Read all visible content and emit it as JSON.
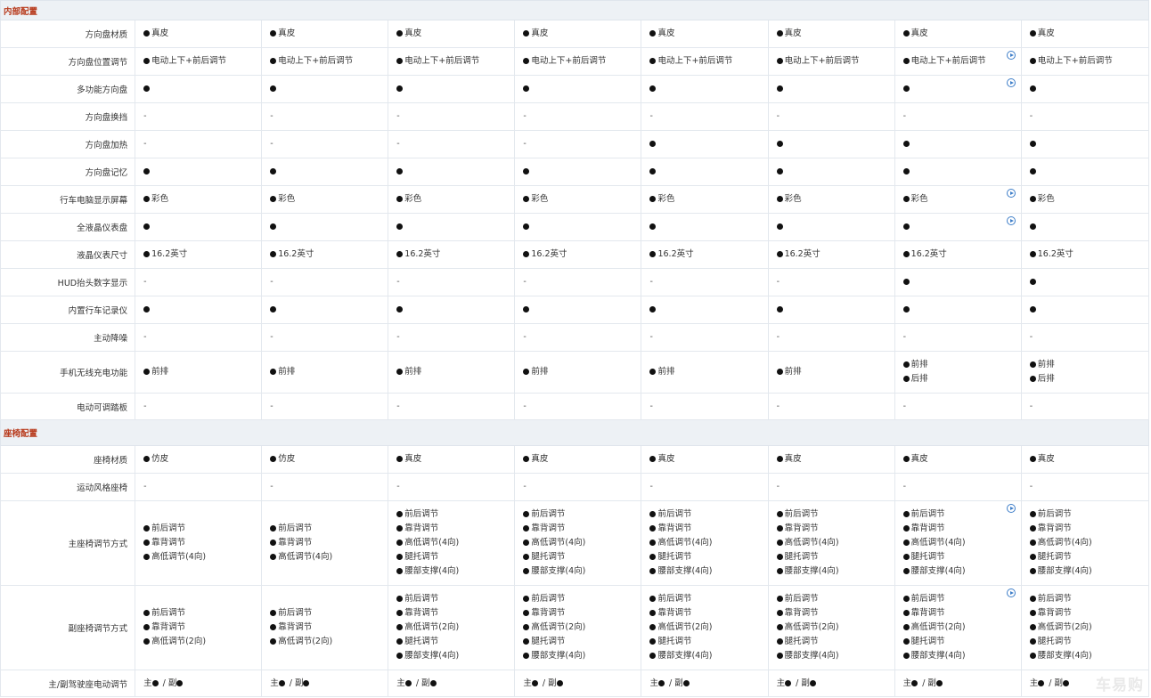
{
  "watermark": "车易购",
  "sections": [
    {
      "title": "内部配置",
      "rows": [
        {
          "label": "方向盘材质",
          "cells": [
            [
              "●真皮"
            ],
            [
              "●真皮"
            ],
            [
              "●真皮"
            ],
            [
              "●真皮"
            ],
            [
              "●真皮"
            ],
            [
              "●真皮"
            ],
            [
              "●真皮"
            ],
            [
              "●真皮"
            ]
          ],
          "icons": []
        },
        {
          "label": "方向盘位置调节",
          "cells": [
            [
              "●电动上下+前后调节"
            ],
            [
              "●电动上下+前后调节"
            ],
            [
              "●电动上下+前后调节"
            ],
            [
              "●电动上下+前后调节"
            ],
            [
              "●电动上下+前后调节"
            ],
            [
              "●电动上下+前后调节"
            ],
            [
              "●电动上下+前后调节"
            ],
            [
              "●电动上下+前后调节"
            ]
          ],
          "icons": [
            6
          ]
        },
        {
          "label": "多功能方向盘",
          "cells": [
            [
              "●"
            ],
            [
              "●"
            ],
            [
              "●"
            ],
            [
              "●"
            ],
            [
              "●"
            ],
            [
              "●"
            ],
            [
              "●"
            ],
            [
              "●"
            ]
          ],
          "icons": [
            6
          ]
        },
        {
          "label": "方向盘换挡",
          "cells": [
            [
              "-"
            ],
            [
              "-"
            ],
            [
              "-"
            ],
            [
              "-"
            ],
            [
              "-"
            ],
            [
              "-"
            ],
            [
              "-"
            ],
            [
              "-"
            ]
          ],
          "icons": []
        },
        {
          "label": "方向盘加热",
          "cells": [
            [
              "-"
            ],
            [
              "-"
            ],
            [
              "-"
            ],
            [
              "-"
            ],
            [
              "●"
            ],
            [
              "●"
            ],
            [
              "●"
            ],
            [
              "●"
            ]
          ],
          "icons": []
        },
        {
          "label": "方向盘记忆",
          "cells": [
            [
              "●"
            ],
            [
              "●"
            ],
            [
              "●"
            ],
            [
              "●"
            ],
            [
              "●"
            ],
            [
              "●"
            ],
            [
              "●"
            ],
            [
              "●"
            ]
          ],
          "icons": []
        },
        {
          "label": "行车电脑显示屏幕",
          "cells": [
            [
              "●彩色"
            ],
            [
              "●彩色"
            ],
            [
              "●彩色"
            ],
            [
              "●彩色"
            ],
            [
              "●彩色"
            ],
            [
              "●彩色"
            ],
            [
              "●彩色"
            ],
            [
              "●彩色"
            ]
          ],
          "icons": [
            6
          ]
        },
        {
          "label": "全液晶仪表盘",
          "cells": [
            [
              "●"
            ],
            [
              "●"
            ],
            [
              "●"
            ],
            [
              "●"
            ],
            [
              "●"
            ],
            [
              "●"
            ],
            [
              "●"
            ],
            [
              "●"
            ]
          ],
          "icons": [
            6
          ]
        },
        {
          "label": "液晶仪表尺寸",
          "cells": [
            [
              "●16.2英寸"
            ],
            [
              "●16.2英寸"
            ],
            [
              "●16.2英寸"
            ],
            [
              "●16.2英寸"
            ],
            [
              "●16.2英寸"
            ],
            [
              "●16.2英寸"
            ],
            [
              "●16.2英寸"
            ],
            [
              "●16.2英寸"
            ]
          ],
          "icons": []
        },
        {
          "label": "HUD抬头数字显示",
          "cells": [
            [
              "-"
            ],
            [
              "-"
            ],
            [
              "-"
            ],
            [
              "-"
            ],
            [
              "-"
            ],
            [
              "-"
            ],
            [
              "●"
            ],
            [
              "●"
            ]
          ],
          "icons": []
        },
        {
          "label": "内置行车记录仪",
          "cells": [
            [
              "●"
            ],
            [
              "●"
            ],
            [
              "●"
            ],
            [
              "●"
            ],
            [
              "●"
            ],
            [
              "●"
            ],
            [
              "●"
            ],
            [
              "●"
            ]
          ],
          "icons": []
        },
        {
          "label": "主动降噪",
          "cells": [
            [
              "-"
            ],
            [
              "-"
            ],
            [
              "-"
            ],
            [
              "-"
            ],
            [
              "-"
            ],
            [
              "-"
            ],
            [
              "-"
            ],
            [
              "-"
            ]
          ],
          "icons": []
        },
        {
          "label": "手机无线充电功能",
          "cells": [
            [
              "●前排"
            ],
            [
              "●前排"
            ],
            [
              "●前排"
            ],
            [
              "●前排"
            ],
            [
              "●前排"
            ],
            [
              "●前排"
            ],
            [
              "●前排",
              "●后排"
            ],
            [
              "●前排",
              "●后排"
            ]
          ],
          "icons": []
        },
        {
          "label": "电动可调踏板",
          "cells": [
            [
              "-"
            ],
            [
              "-"
            ],
            [
              "-"
            ],
            [
              "-"
            ],
            [
              "-"
            ],
            [
              "-"
            ],
            [
              "-"
            ],
            [
              "-"
            ]
          ],
          "icons": []
        }
      ]
    },
    {
      "title": "座椅配置",
      "rows": [
        {
          "label": "座椅材质",
          "cells": [
            [
              "●仿皮"
            ],
            [
              "●仿皮"
            ],
            [
              "●真皮"
            ],
            [
              "●真皮"
            ],
            [
              "●真皮"
            ],
            [
              "●真皮"
            ],
            [
              "●真皮"
            ],
            [
              "●真皮"
            ]
          ],
          "icons": []
        },
        {
          "label": "运动风格座椅",
          "cells": [
            [
              "-"
            ],
            [
              "-"
            ],
            [
              "-"
            ],
            [
              "-"
            ],
            [
              "-"
            ],
            [
              "-"
            ],
            [
              "-"
            ],
            [
              "-"
            ]
          ],
          "icons": []
        },
        {
          "label": "主座椅调节方式",
          "cells": [
            [
              "●前后调节",
              "●靠背调节",
              "●高低调节(4向)"
            ],
            [
              "●前后调节",
              "●靠背调节",
              "●高低调节(4向)"
            ],
            [
              "●前后调节",
              "●靠背调节",
              "●高低调节(4向)",
              "●腿托调节",
              "●腰部支撑(4向)"
            ],
            [
              "●前后调节",
              "●靠背调节",
              "●高低调节(4向)",
              "●腿托调节",
              "●腰部支撑(4向)"
            ],
            [
              "●前后调节",
              "●靠背调节",
              "●高低调节(4向)",
              "●腿托调节",
              "●腰部支撑(4向)"
            ],
            [
              "●前后调节",
              "●靠背调节",
              "●高低调节(4向)",
              "●腿托调节",
              "●腰部支撑(4向)"
            ],
            [
              "●前后调节",
              "●靠背调节",
              "●高低调节(4向)",
              "●腿托调节",
              "●腰部支撑(4向)"
            ],
            [
              "●前后调节",
              "●靠背调节",
              "●高低调节(4向)",
              "●腿托调节",
              "●腰部支撑(4向)"
            ]
          ],
          "icons": [
            6
          ]
        },
        {
          "label": "副座椅调节方式",
          "cells": [
            [
              "●前后调节",
              "●靠背调节",
              "●高低调节(2向)"
            ],
            [
              "●前后调节",
              "●靠背调节",
              "●高低调节(2向)"
            ],
            [
              "●前后调节",
              "●靠背调节",
              "●高低调节(2向)",
              "●腿托调节",
              "●腰部支撑(4向)"
            ],
            [
              "●前后调节",
              "●靠背调节",
              "●高低调节(2向)",
              "●腿托调节",
              "●腰部支撑(4向)"
            ],
            [
              "●前后调节",
              "●靠背调节",
              "●高低调节(2向)",
              "●腿托调节",
              "●腰部支撑(4向)"
            ],
            [
              "●前后调节",
              "●靠背调节",
              "●高低调节(2向)",
              "●腿托调节",
              "●腰部支撑(4向)"
            ],
            [
              "●前后调节",
              "●靠背调节",
              "●高低调节(2向)",
              "●腿托调节",
              "●腰部支撑(4向)"
            ],
            [
              "●前后调节",
              "●靠背调节",
              "●高低调节(2向)",
              "●腿托调节",
              "●腰部支撑(4向)"
            ]
          ],
          "icons": [
            6
          ]
        },
        {
          "label": "主/副驾驶座电动调节",
          "cells": [
            [
              "主● / 副●"
            ],
            [
              "主● / 副●"
            ],
            [
              "主● / 副●"
            ],
            [
              "主● / 副●"
            ],
            [
              "主● / 副●"
            ],
            [
              "主● / 副●"
            ],
            [
              "主● / 副●"
            ],
            [
              "主● / 副●"
            ]
          ],
          "icons": []
        }
      ]
    }
  ]
}
